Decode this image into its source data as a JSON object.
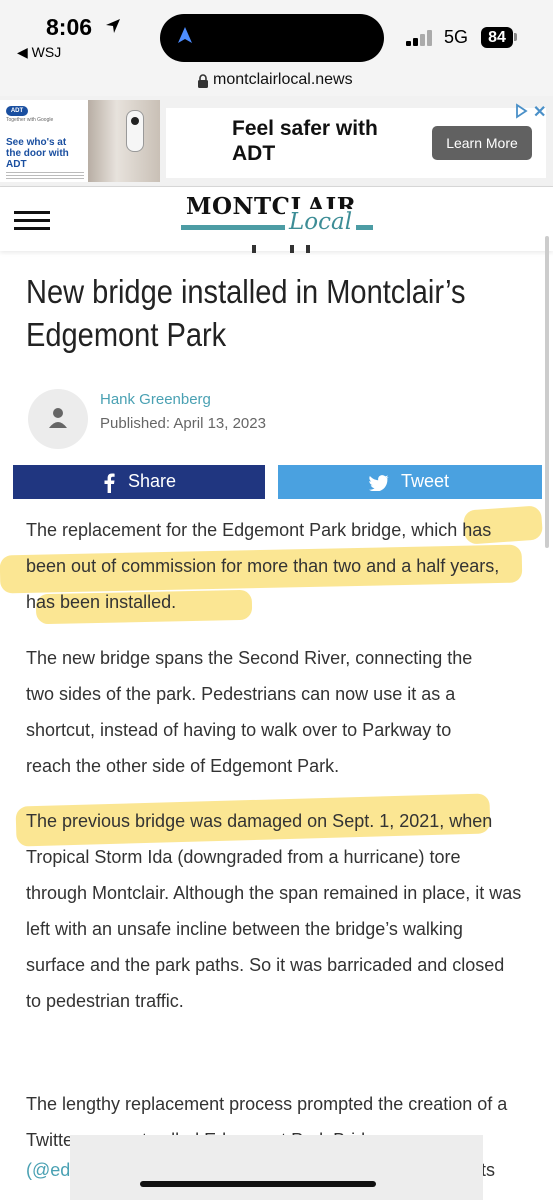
{
  "status": {
    "time": "8:06",
    "back_app": "◀ WSJ",
    "network": "5G",
    "battery": "84"
  },
  "browser": {
    "url": "montclairlocal.news"
  },
  "ad": {
    "brand": "ADT",
    "small_text": "Together with Google",
    "left_headline": "See who's at the door with ADT",
    "title": "Feel safer with ADT",
    "button": "Learn More"
  },
  "site": {
    "logo_top": "MONTCLAIR",
    "logo_script": "Local"
  },
  "article": {
    "title": "New bridge installed in Montclair’s Edgemont Park",
    "author": "Hank Greenberg",
    "published": "Published: April 13, 2023",
    "share_label": "Share",
    "tweet_label": "Tweet",
    "paragraphs": [
      "The replacement for the Edgemont Park bridge, which has been out of commission for more than two and a half years, has been installed.",
      "The new bridge spans the Second River, connecting the two sides of the park. Pedestrians can now use it as a shortcut, instead of having to walk over to Parkway to reach the other side of Edgemont Park.",
      "The previous bridge was damaged on Sept. 1, 2021, when Tropical Storm Ida (downgraded from a hurricane) tore through Montclair. Although the span remained in place, it was left with an unsafe incline between the bridge’s walking surface and the park paths. So it was barricaded and closed to pedestrian traffic.",
      "The lengthy replacement process prompted the creation of a Twitter account called Edgemont Park Bridge"
    ],
    "cut_link": "(@ed",
    "cut_end": "ts"
  },
  "colors": {
    "facebook": "#203680",
    "twitter": "#4aa1e0",
    "highlight": "#f7d13a",
    "accent": "#4aa1b3"
  }
}
